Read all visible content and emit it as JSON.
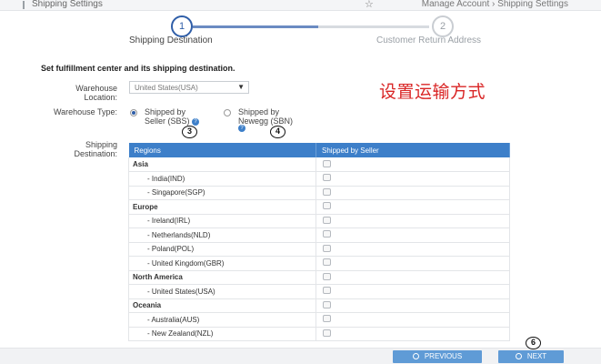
{
  "header": {
    "title": "Shipping Settings",
    "breadcrumb": {
      "parent": "Manage Account",
      "separator": "›",
      "current": "Shipping Settings"
    }
  },
  "steps": [
    {
      "number": "1",
      "label": "Shipping Destination",
      "active": true
    },
    {
      "number": "2",
      "label": "Customer Return Address",
      "active": false
    }
  ],
  "section_title": "Set fulfillment center and its shipping destination.",
  "annotation_text": "设置运输方式",
  "warehouse": {
    "label": "Warehouse Location:",
    "value": "United States(USA)"
  },
  "warehouse_type": {
    "label": "Warehouse Type:",
    "options": [
      {
        "label": "Shipped by Seller (SBS)",
        "selected": true
      },
      {
        "label": "Shipped by Newegg (SBN)",
        "selected": false
      }
    ]
  },
  "markers": {
    "m3": "3",
    "m4": "4",
    "m6": "6"
  },
  "destination": {
    "label": "Shipping Destination:",
    "columns": [
      "Regions",
      "Shipped by Seller"
    ],
    "rows": [
      {
        "name": "Asia",
        "type": "region"
      },
      {
        "name": "- India(IND)",
        "type": "country"
      },
      {
        "name": "- Singapore(SGP)",
        "type": "country"
      },
      {
        "name": "Europe",
        "type": "region"
      },
      {
        "name": "- Ireland(IRL)",
        "type": "country"
      },
      {
        "name": "- Netherlands(NLD)",
        "type": "country"
      },
      {
        "name": "- Poland(POL)",
        "type": "country"
      },
      {
        "name": "- United Kingdom(GBR)",
        "type": "country"
      },
      {
        "name": "North America",
        "type": "region"
      },
      {
        "name": "- United States(USA)",
        "type": "country"
      },
      {
        "name": "Oceania",
        "type": "region"
      },
      {
        "name": "- Australia(AUS)",
        "type": "country"
      },
      {
        "name": "- New Zealand(NZL)",
        "type": "country"
      }
    ]
  },
  "buttons": {
    "previous": "PREVIOUS",
    "next": "NEXT"
  },
  "colors": {
    "accent": "#3d7fc9",
    "annotation": "#d92525"
  }
}
